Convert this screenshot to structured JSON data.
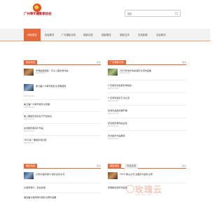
{
  "header": {
    "logo_text": "广州青年摄影家协会",
    "search_placeholder": "搜索"
  },
  "nav": {
    "items": [
      "网站首页",
      "协会概况",
      "广东摄影动态",
      "摄影动态",
      "摄影展览",
      "摄影交流",
      "在线影展",
      "协会概况"
    ],
    "active_index": 0
  },
  "panels": {
    "left_top": {
      "tab": "协会动态",
      "more": "更多",
      "items": [
        {
          "title": "羊同拍摄联盟，可以入围优秀作品",
          "date": "2019-06-12"
        },
        {
          "title": "第七届广州青年摄影交流展通知",
          "date": "2023-04-20"
        },
        {
          "title": "第七届广州青年摄影交流展",
          "date": "2023-04-20"
        },
        {
          "title": "第二期摄影培训班于开班信息",
          "date": "2023-03-20"
        },
        {
          "title": "在线摄影展演示作品",
          "date": "2023-03-10"
        },
        {
          "title": "2021新一期摄影培训营",
          "date": "2023-03-01"
        }
      ]
    },
    "right_top": {
      "tab": "广东摄影动态",
      "more": "更多",
      "items": [
        {
          "title": "2023年地方色彩摄影交流作品展",
          "date": "2023-05-12"
        },
        {
          "title": "广东摄影协会摄影体验会",
          "date": "2023-04-15"
        },
        {
          "title": "广东青年摄影艺术交流",
          "date": "2023-04-10"
        },
        {
          "title": "优秀作品摄影展开展",
          "date": "2023-03-28"
        },
        {
          "title": "纪实摄影展作品征集",
          "date": "2023-03-15"
        },
        {
          "title": "风光摄影作品展览",
          "date": "2023-03-05"
        }
      ]
    },
    "left_bottom": {
      "tab": "摄影动态",
      "more": "更多",
      "items": [
        {
          "title": "记录大美南海湾 摄影采风交流"
        },
        {
          "title": "大美南海湾，最后的美"
        },
        {
          "title": "第四届大美南海湾摄影大赛作品展"
        }
      ]
    },
    "right_bottom": {
      "tab": "摄影展览",
      "tab2": "作品交流",
      "more": "更多",
      "items": [
        {
          "title": "2024 鹰山大河 全国风光摄影大赛"
        },
        {
          "title": "青春精彩摄影作品展"
        }
      ]
    }
  },
  "watermark": {
    "text": "玫瑰云",
    "subtext": "www.ixxxx.com"
  }
}
